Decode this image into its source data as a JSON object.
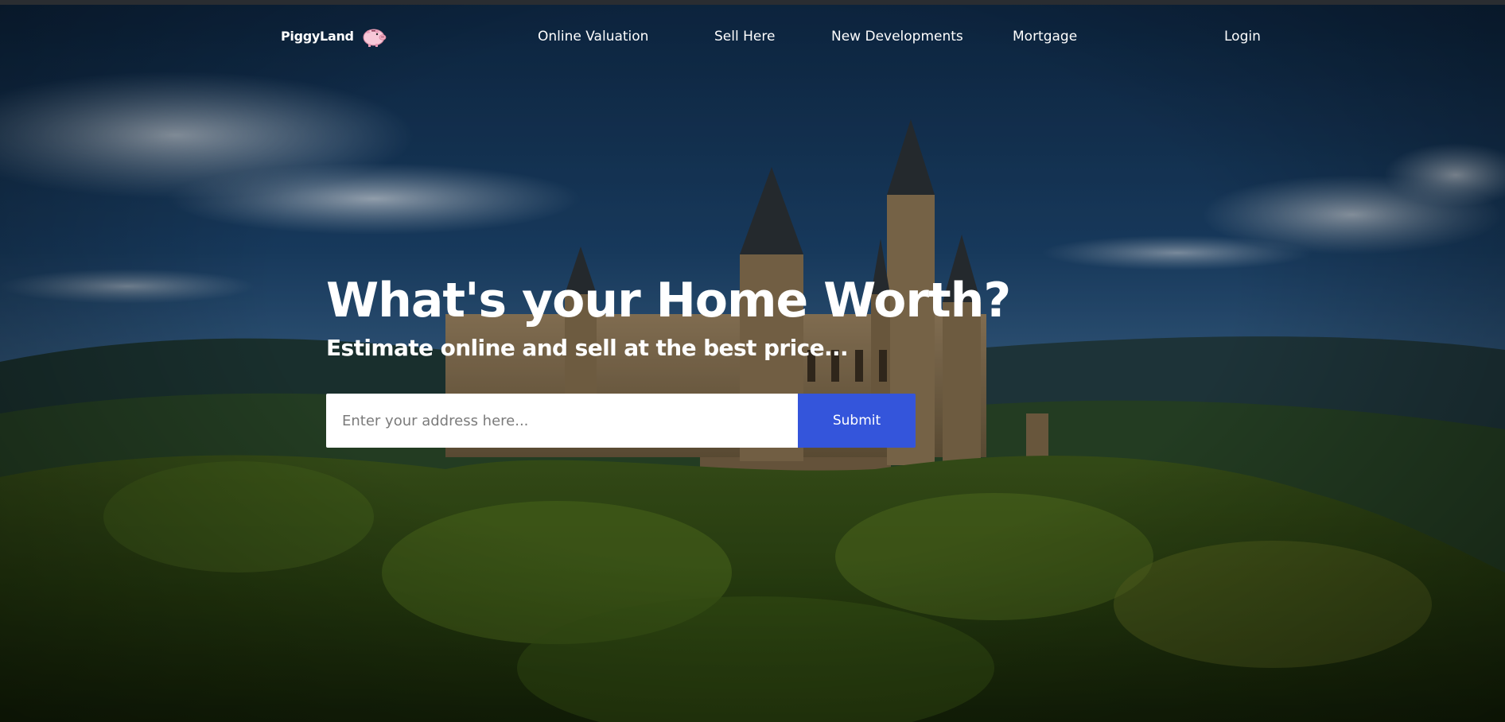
{
  "brand": {
    "name": "PiggyLand",
    "logo_icon": "piggy-bank-icon",
    "accent_color": "#3455db"
  },
  "nav": {
    "items": [
      {
        "label": "Online Valuation"
      },
      {
        "label": "Sell Here"
      },
      {
        "label": "New Developments"
      },
      {
        "label": "Mortgage"
      }
    ],
    "login_label": "Login"
  },
  "hero": {
    "title": "What's your Home Worth?",
    "subtitle": "Estimate online and sell at the best price...",
    "search": {
      "placeholder": "Enter your address here...",
      "value": "",
      "submit_label": "Submit"
    },
    "background": "castle-on-forested-hill-photo"
  }
}
